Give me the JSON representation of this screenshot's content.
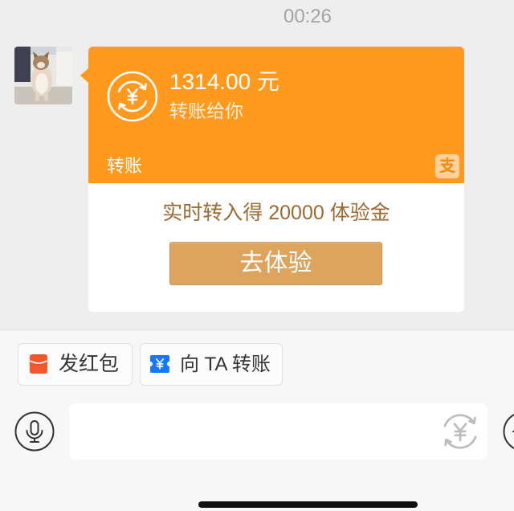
{
  "status_bar": {
    "timestamp": "00:26"
  },
  "transfer_card": {
    "icon": "yuan-transfer-icon",
    "amount": "1314.00 元",
    "note": "转账给你",
    "type_label": "转账",
    "brand_logo": {
      "icon": "alipay-logo-icon",
      "glyph": "支"
    },
    "promo_text": "实时转入得 20000 体验金",
    "cta_label": "去体验"
  },
  "quick_actions": [
    {
      "label": "发红包",
      "icon": "red-envelope-icon"
    },
    {
      "label": "向 TA 转账",
      "icon": "transfer-ticket-icon"
    }
  ],
  "composer": {
    "voice_icon": "microphone-icon",
    "input_value": "",
    "transfer_icon": "yuan-transfer-icon",
    "more_icon": "add-circle-icon"
  },
  "colors": {
    "transfer_orange": "#FF9A1E",
    "cta_gold": "#DCA45C",
    "promo_text": "#9C6A32",
    "red_envelope": "#F4572C",
    "transfer_blue": "#1677FF",
    "chat_background": "#EEEEEE"
  }
}
